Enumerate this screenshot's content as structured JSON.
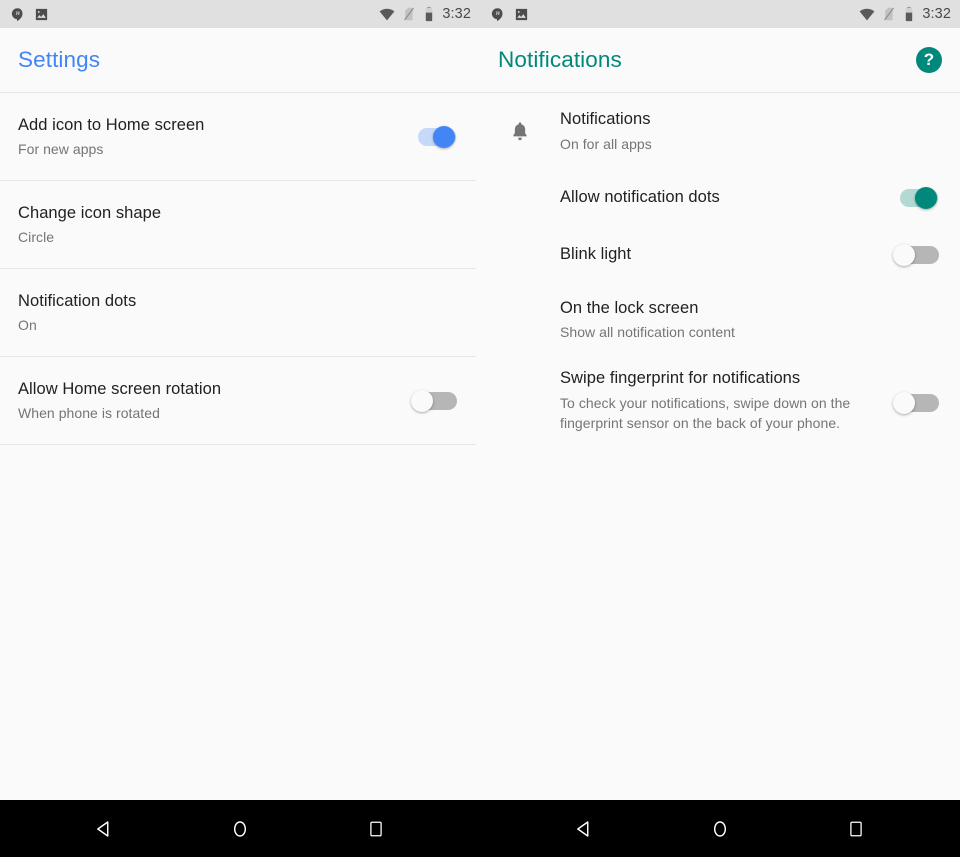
{
  "statusbar": {
    "icons_left": [
      "hangouts-icon",
      "image-icon"
    ],
    "icons_right": [
      "wifi-icon",
      "no-sim-icon",
      "battery-icon"
    ],
    "time": "3:32"
  },
  "left_panel": {
    "appbar": {
      "title": "Settings",
      "accent_color": "#4285f4"
    },
    "rows": [
      {
        "title": "Add icon to Home screen",
        "subtitle": "For new apps",
        "control": "switch",
        "state": "on",
        "color": "#4285f4"
      },
      {
        "title": "Change icon shape",
        "subtitle": "Circle",
        "control": "none"
      },
      {
        "title": "Notification dots",
        "subtitle": "On",
        "control": "none"
      },
      {
        "title": "Allow Home screen rotation",
        "subtitle": "When phone is rotated",
        "control": "switch",
        "state": "off"
      }
    ]
  },
  "right_panel": {
    "appbar": {
      "title": "Notifications",
      "accent_color": "#00897b",
      "help_label": "?"
    },
    "rows": [
      {
        "icon": "bell-icon",
        "title": "Notifications",
        "subtitle": "On for all apps",
        "control": "none"
      },
      {
        "title": "Allow notification dots",
        "subtitle": "",
        "control": "switch",
        "state": "on",
        "color": "#00897b"
      },
      {
        "title": "Blink light",
        "subtitle": "",
        "control": "switch",
        "state": "off"
      },
      {
        "title": "On the lock screen",
        "subtitle": "Show all notification content",
        "control": "none"
      },
      {
        "title": "Swipe fingerprint for notifications",
        "subtitle": "To check your notifications, swipe down on the fingerprint sensor on the back of your phone.",
        "control": "switch",
        "state": "off"
      }
    ]
  },
  "navbar": {
    "buttons": [
      "back-button",
      "home-button",
      "recents-button"
    ]
  }
}
